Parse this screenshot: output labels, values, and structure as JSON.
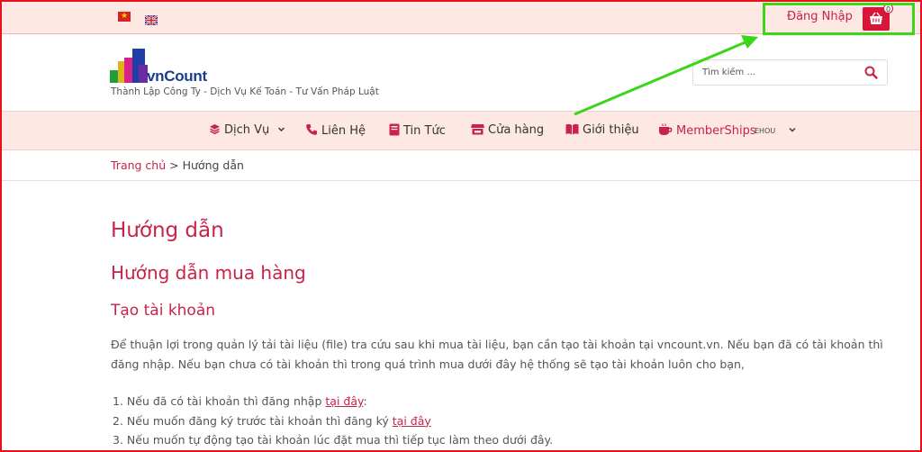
{
  "topbar": {
    "languages": [
      {
        "code": "vi",
        "icon": "vietnam-flag-icon"
      },
      {
        "code": "en",
        "icon": "uk-flag-icon"
      }
    ],
    "login_label": "Đăng Nhập",
    "cart_count": "0",
    "cart_icon": "basket-icon",
    "colors": {
      "background": "#fde8e3",
      "accent": "#d8163a",
      "highlight": "#3bd61a"
    }
  },
  "header": {
    "logo_text": "vnCount",
    "tagline": "Thành Lập Công Ty - Dịch Vụ Kế Toán - Tư Vấn Pháp Luật",
    "search_placeholder": "Tìm kiếm ...",
    "search_icon": "search-icon"
  },
  "nav": {
    "items": [
      {
        "label": "Dịch Vụ",
        "icon": "layers-icon",
        "has_dropdown": true
      },
      {
        "label": "Liên Hệ",
        "icon": "phone-icon"
      },
      {
        "label": "Tin Tức",
        "icon": "newspaper-icon"
      },
      {
        "label": "Cửa hàng",
        "icon": "store-icon"
      },
      {
        "label": "Giới thiệu",
        "icon": "book-open-icon"
      },
      {
        "label": "MemberShips",
        "icon": "coffee-icon"
      }
    ],
    "extra": "EHOU"
  },
  "breadcrumb": {
    "home": "Trang chủ",
    "separator": ">",
    "current": "Hướng dẫn"
  },
  "content": {
    "title": "Hướng dẫn",
    "subtitle": "Hướng dẫn mua hàng",
    "section": "Tạo tài khoản",
    "paragraph": "Để thuận lợi trong quản lý tải tài liệu (file) tra cứu sau khi mua tài liệu, bạn cần tạo tài khoản tại vncount.vn. Nếu bạn đã có tài khoản thì đăng nhập. Nếu bạn chưa có tài khoản thì trong quá trình mua dưới đây hệ thống sẽ tạo tài khoản luôn cho bạn,",
    "list": [
      {
        "prefix": "1. Nếu đã có tài khoản thì đăng nhập ",
        "link": "tại đây",
        "suffix": ":"
      },
      {
        "prefix": "2. Nếu muốn đăng ký trước tài khoản thì đăng ký ",
        "link": "tại đây",
        "suffix": ""
      },
      {
        "prefix": "3. Nếu muốn tự động tạo tài khoản lúc đặt mua thì tiếp tục làm theo dưới đây.",
        "link": "",
        "suffix": ""
      }
    ]
  }
}
